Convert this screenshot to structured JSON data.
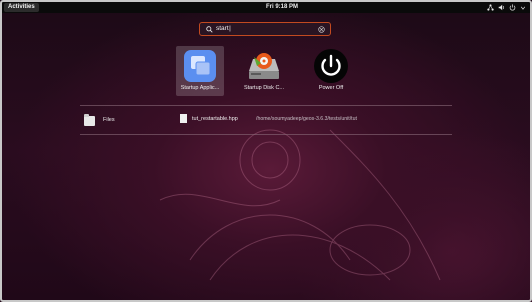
{
  "topbar": {
    "activities_label": "Activities",
    "clock": "Fri 9:18 PM",
    "tray_icons": [
      "network-icon",
      "volume-icon",
      "power-icon",
      "chevron-down-icon"
    ]
  },
  "search": {
    "value": "start",
    "icon": "search-icon",
    "clear_icon": "clear-icon"
  },
  "apps": [
    {
      "label": "Startup Applic...",
      "icon": "startup-applications-icon",
      "selected": true
    },
    {
      "label": "Startup Disk C...",
      "icon": "startup-disk-creator-icon",
      "selected": false
    },
    {
      "label": "Power Off",
      "icon": "power-off-icon",
      "selected": false
    }
  ],
  "files_result": {
    "provider_label": "Files",
    "provider_icon": "files-icon",
    "items": [
      {
        "name": "tut_restartable.hpp",
        "path": "/home/soumyadeep/geos-3.6.3/tests/unit/tut",
        "icon": "document-icon"
      }
    ]
  },
  "colors": {
    "accent": "#c24a20",
    "background": "#3a0f26",
    "topbar": "#0a0a0a",
    "startup_app_blue": "#5b8ff0"
  }
}
